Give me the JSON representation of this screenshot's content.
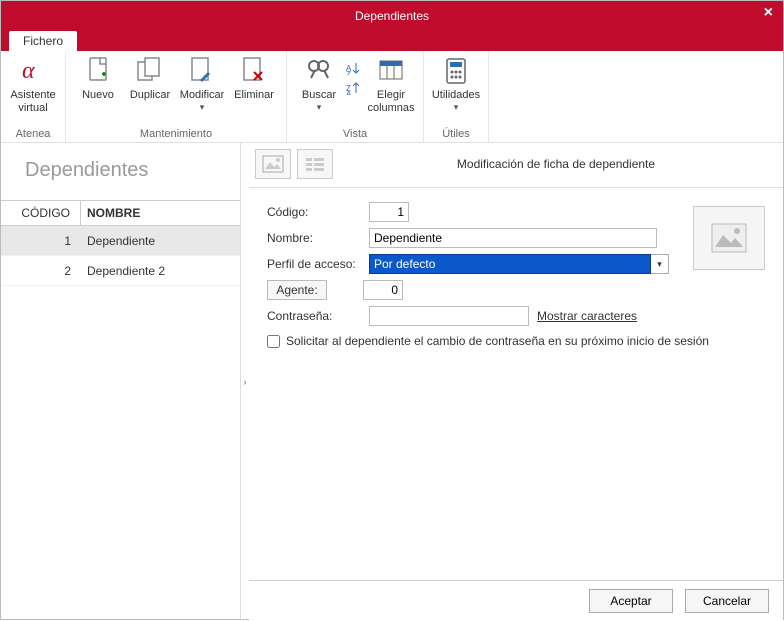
{
  "window": {
    "title": "Dependientes"
  },
  "ribbon": {
    "tab": "Fichero",
    "groups": {
      "atenea": {
        "label": "Atenea",
        "assistant": "Asistente\nvirtual"
      },
      "mantenimiento": {
        "label": "Mantenimiento",
        "nuevo": "Nuevo",
        "duplicar": "Duplicar",
        "modificar": "Modificar",
        "eliminar": "Eliminar"
      },
      "vista": {
        "label": "Vista",
        "buscar": "Buscar",
        "elegir_columnas": "Elegir\ncolumnas"
      },
      "utiles": {
        "label": "Útiles",
        "utilidades": "Utilidades"
      }
    }
  },
  "list": {
    "title": "Dependientes",
    "cols": {
      "codigo": "CÓDIGO",
      "nombre": "NOMBRE"
    },
    "rows": [
      {
        "codigo": "1",
        "nombre": "Dependiente"
      },
      {
        "codigo": "2",
        "nombre": "Dependiente 2"
      }
    ]
  },
  "form": {
    "title": "Modificación de ficha de dependiente",
    "labels": {
      "codigo": "Código:",
      "nombre": "Nombre:",
      "perfil": "Perfil de acceso:",
      "agente": "Agente:",
      "contrasena": "Contraseña:",
      "mostrar": "Mostrar caracteres",
      "solicitar": "Solicitar al dependiente el cambio de contraseña en su próximo inicio de sesión"
    },
    "values": {
      "codigo": "1",
      "nombre": "Dependiente",
      "perfil": "Por defecto",
      "agente": "0",
      "contrasena": ""
    }
  },
  "footer": {
    "aceptar": "Aceptar",
    "cancelar": "Cancelar"
  }
}
